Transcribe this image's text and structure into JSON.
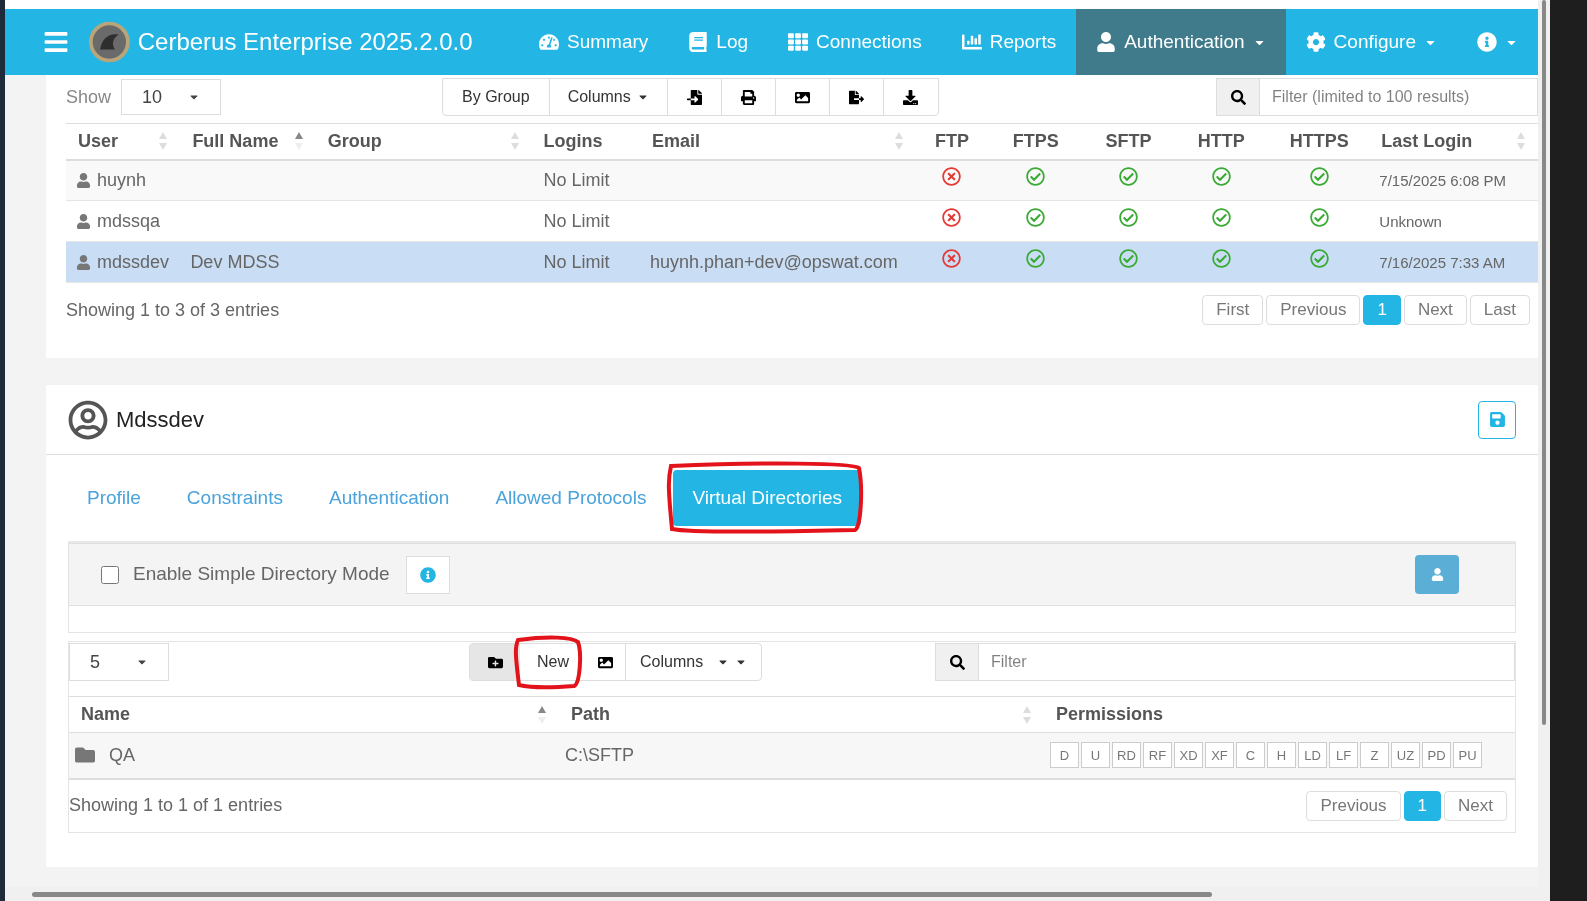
{
  "app": {
    "title": "Cerberus Enterprise 2025.2.0.0"
  },
  "nav": [
    {
      "kind": "summary",
      "label": "Summary",
      "selected": false,
      "dropdown": false
    },
    {
      "kind": "log",
      "label": "Log",
      "selected": false,
      "dropdown": false
    },
    {
      "kind": "connections",
      "label": "Connections",
      "selected": false,
      "dropdown": false
    },
    {
      "kind": "reports",
      "label": "Reports",
      "selected": false,
      "dropdown": false
    },
    {
      "kind": "authentication",
      "label": "Authentication",
      "selected": true,
      "dropdown": true
    },
    {
      "kind": "configure",
      "label": "Configure",
      "selected": false,
      "dropdown": true
    },
    {
      "kind": "info",
      "selected": false,
      "dropdown": true
    }
  ],
  "users": {
    "show_label": "Show",
    "page_size": "10",
    "buttons": [
      "By Group"
    ],
    "columns_button": "Columns",
    "filter_placeholder": "Filter (limited to 100 results)",
    "columns": [
      {
        "label": "User",
        "sortable": true,
        "sorted": false
      },
      {
        "label": "Full Name",
        "sortable": true,
        "sorted": true
      },
      {
        "label": "Group",
        "sortable": true,
        "sorted": false
      },
      {
        "label": "Logins",
        "sortable": false
      },
      {
        "label": "Email",
        "sortable": true,
        "sorted": false
      },
      {
        "label": "FTP",
        "sortable": false
      },
      {
        "label": "FTPS",
        "sortable": false
      },
      {
        "label": "SFTP",
        "sortable": false
      },
      {
        "label": "HTTP",
        "sortable": false
      },
      {
        "label": "HTTPS",
        "sortable": false
      },
      {
        "label": "Last Login",
        "sortable": true,
        "sorted": false
      }
    ],
    "rows": [
      {
        "user": "huynh",
        "logins": "No Limit",
        "protocols": [
          false,
          true,
          true,
          true,
          true
        ],
        "last_login": "7/15/2025 6:08 PM",
        "selected": false
      },
      {
        "user": "mdssqa",
        "logins": "No Limit",
        "protocols": [
          false,
          true,
          true,
          true,
          true
        ],
        "last_login": "Unknown",
        "selected": false
      },
      {
        "user": "mdssdev",
        "full_name": "Dev MDSS",
        "logins": "No Limit",
        "email": "huynh.phan+dev@opswat.com",
        "protocols": [
          false,
          true,
          true,
          true,
          true
        ],
        "last_login": "7/16/2025 7:33 AM",
        "selected": true
      }
    ],
    "footer": "Showing 1 to 3 of 3 entries",
    "pagination": [
      {
        "label": "First",
        "selected": false
      },
      {
        "label": "Previous",
        "selected": false
      },
      {
        "label": "1",
        "selected": true
      },
      {
        "label": "Next",
        "selected": false
      },
      {
        "label": "Last",
        "selected": false
      }
    ]
  },
  "detail": {
    "name": "Mdssdev",
    "tabs": [
      {
        "label": "Profile",
        "selected": false,
        "highlighted": false
      },
      {
        "label": "Constraints",
        "selected": false,
        "highlighted": false
      },
      {
        "label": "Authentication",
        "selected": false,
        "highlighted": false
      },
      {
        "label": "Allowed Protocols",
        "selected": false,
        "highlighted": false
      },
      {
        "label": "Virtual Directories",
        "selected": true,
        "highlighted": true
      }
    ],
    "simple_mode": {
      "label": "Enable Simple Directory Mode",
      "checked": false
    },
    "dirs": {
      "page_size": "5",
      "new_button": {
        "label": "New",
        "highlighted": true
      },
      "columns_button": "Columns",
      "filter_placeholder": "Filter",
      "columns": [
        {
          "label": "Name",
          "sortable": true,
          "sorted": true
        },
        {
          "label": "Path",
          "sortable": true,
          "sorted": false
        },
        {
          "label": "Permissions",
          "sortable": false
        }
      ],
      "rows": [
        {
          "name": "QA",
          "path": "C:\\SFTP",
          "permissions": [
            "D",
            "U",
            "RD",
            "RF",
            "XD",
            "XF",
            "C",
            "H",
            "LD",
            "LF",
            "Z",
            "UZ",
            "PD",
            "PU"
          ]
        }
      ],
      "footer": "Showing 1 to 1 of 1 entries",
      "pagination": [
        {
          "label": "Previous",
          "selected": false
        },
        {
          "label": "1",
          "selected": true
        },
        {
          "label": "Next",
          "selected": false
        }
      ]
    }
  }
}
